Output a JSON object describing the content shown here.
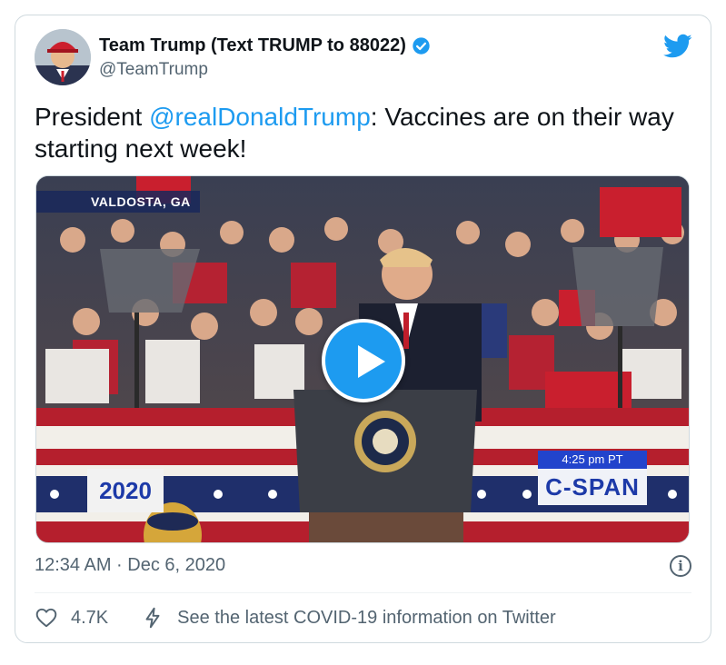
{
  "tweet": {
    "display_name": "Team Trump (Text TRUMP to 88022)",
    "handle": "@TeamTrump",
    "text_prefix": "President ",
    "mention": "@realDonaldTrump",
    "text_suffix": ": Vaccines are on their way starting next week!",
    "timestamp": "12:34 AM · Dec 6, 2020",
    "like_count": "4.7K",
    "covid_link": "See the latest COVID-19 information on Twitter"
  },
  "video": {
    "location_tag": "VALDOSTA, GA",
    "time_tag": "4:25 pm PT",
    "network": "C-SPAN",
    "logo_text": "2020"
  },
  "icons": {
    "brand": "twitter-bird-icon",
    "verified": "verified-badge-icon",
    "play": "play-icon",
    "info": "info-icon",
    "like": "heart-icon",
    "covid": "bolt-icon"
  },
  "colors": {
    "accent": "#1d9bf0",
    "text": "#0f1419",
    "muted": "#536471",
    "border": "#cfd9de"
  }
}
